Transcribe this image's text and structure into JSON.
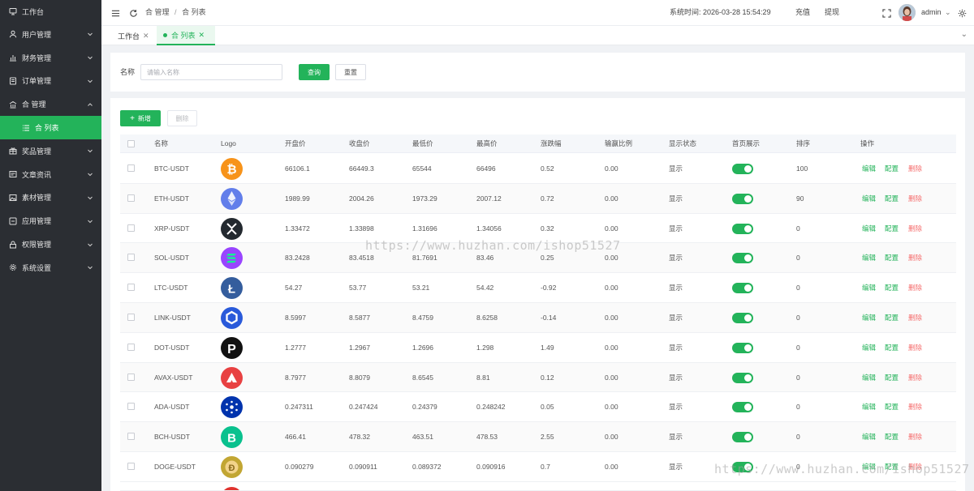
{
  "sidebar": {
    "items": [
      {
        "label": "工作台",
        "icon": "monitor-icon",
        "chevron": false
      },
      {
        "label": "用户管理",
        "icon": "user-icon",
        "chevron": true
      },
      {
        "label": "财务管理",
        "icon": "bar-chart-icon",
        "chevron": true
      },
      {
        "label": "订单管理",
        "icon": "order-icon",
        "chevron": true
      },
      {
        "label": "合  管理",
        "icon": "bank-icon",
        "chevron": true,
        "expanded": true
      },
      {
        "label": "合  列表",
        "icon": "list-icon",
        "sub": true,
        "active": true
      },
      {
        "label": "奖品管理",
        "icon": "gift-icon",
        "chevron": true
      },
      {
        "label": "文章资讯",
        "icon": "article-icon",
        "chevron": true
      },
      {
        "label": "素材管理",
        "icon": "image-icon",
        "chevron": true
      },
      {
        "label": "应用管理",
        "icon": "app-icon",
        "chevron": true
      },
      {
        "label": "权限管理",
        "icon": "lock-icon",
        "chevron": true
      },
      {
        "label": "系统设置",
        "icon": "gear-icon",
        "chevron": true
      }
    ]
  },
  "topbar": {
    "breadcrumb_1": "合  管理",
    "breadcrumb_sep": "/",
    "breadcrumb_2": "合  列表",
    "time_label": "系统时间: 2026-03-28 15:54:29",
    "recharge": "充值",
    "withdraw": "提现",
    "username": "admin"
  },
  "tabs": [
    {
      "label": "工作台",
      "active": false
    },
    {
      "label": "合  列表",
      "active": true
    }
  ],
  "search": {
    "name_label": "名称",
    "name_placeholder": "请输入名称",
    "query_button": "查询",
    "reset_button": "重置"
  },
  "toolbar": {
    "add_button": "新增",
    "delete_button": "删除"
  },
  "table": {
    "headers": [
      "名称",
      "Logo",
      "开盘价",
      "收盘价",
      "最低价",
      "最高价",
      "涨跌幅",
      "输赢比例",
      "显示状态",
      "首页展示",
      "排序",
      "操作"
    ],
    "actions": [
      "编辑",
      "配置",
      "删除"
    ],
    "rows": [
      {
        "name": "BTC-USDT",
        "logo": "btc",
        "logo_color": "#f7931a",
        "open": "66106.1",
        "close": "66449.3",
        "low": "65544",
        "high": "66496",
        "change": "0.52",
        "ratio": "0.00",
        "status": "显示",
        "home": true,
        "sort": "100"
      },
      {
        "name": "ETH-USDT",
        "logo": "eth",
        "logo_color": "#627eea",
        "open": "1989.99",
        "close": "2004.26",
        "low": "1973.29",
        "high": "2007.12",
        "change": "0.72",
        "ratio": "0.00",
        "status": "显示",
        "home": true,
        "sort": "90"
      },
      {
        "name": "XRP-USDT",
        "logo": "xrp",
        "logo_color": "#23292f",
        "open": "1.33472",
        "close": "1.33898",
        "low": "1.31696",
        "high": "1.34056",
        "change": "0.32",
        "ratio": "0.00",
        "status": "显示",
        "home": true,
        "sort": "0"
      },
      {
        "name": "SOL-USDT",
        "logo": "sol",
        "logo_color": "#9945ff",
        "open": "83.2428",
        "close": "83.4518",
        "low": "81.7691",
        "high": "83.46",
        "change": "0.25",
        "ratio": "0.00",
        "status": "显示",
        "home": true,
        "sort": "0"
      },
      {
        "name": "LTC-USDT",
        "logo": "ltc",
        "logo_color": "#345d9d",
        "open": "54.27",
        "close": "53.77",
        "low": "53.21",
        "high": "54.42",
        "change": "-0.92",
        "ratio": "0.00",
        "status": "显示",
        "home": true,
        "sort": "0"
      },
      {
        "name": "LINK-USDT",
        "logo": "link",
        "logo_color": "#2a5ada",
        "open": "8.5997",
        "close": "8.5877",
        "low": "8.4759",
        "high": "8.6258",
        "change": "-0.14",
        "ratio": "0.00",
        "status": "显示",
        "home": true,
        "sort": "0"
      },
      {
        "name": "DOT-USDT",
        "logo": "dot",
        "logo_color": "#111111",
        "open": "1.2777",
        "close": "1.2967",
        "low": "1.2696",
        "high": "1.298",
        "change": "1.49",
        "ratio": "0.00",
        "status": "显示",
        "home": true,
        "sort": "0"
      },
      {
        "name": "AVAX-USDT",
        "logo": "avax",
        "logo_color": "#e84142",
        "open": "8.7977",
        "close": "8.8079",
        "low": "8.6545",
        "high": "8.81",
        "change": "0.12",
        "ratio": "0.00",
        "status": "显示",
        "home": true,
        "sort": "0"
      },
      {
        "name": "ADA-USDT",
        "logo": "ada",
        "logo_color": "#0033ad",
        "open": "0.247311",
        "close": "0.247424",
        "low": "0.24379",
        "high": "0.248242",
        "change": "0.05",
        "ratio": "0.00",
        "status": "显示",
        "home": true,
        "sort": "0"
      },
      {
        "name": "BCH-USDT",
        "logo": "bch",
        "logo_color": "#0ac18e",
        "open": "466.41",
        "close": "478.32",
        "low": "463.51",
        "high": "478.53",
        "change": "2.55",
        "ratio": "0.00",
        "status": "显示",
        "home": true,
        "sort": "0"
      },
      {
        "name": "DOGE-USDT",
        "logo": "doge",
        "logo_color": "#c2a633",
        "open": "0.090279",
        "close": "0.090911",
        "low": "0.089372",
        "high": "0.090916",
        "change": "0.7",
        "ratio": "0.00",
        "status": "显示",
        "home": true,
        "sort": "0"
      }
    ]
  },
  "watermark": "https://www.huzhan.com/ishop51527",
  "colors": {
    "accent": "#23b35a",
    "danger": "#f56c6c",
    "sidebar_bg": "#2b2e33"
  }
}
